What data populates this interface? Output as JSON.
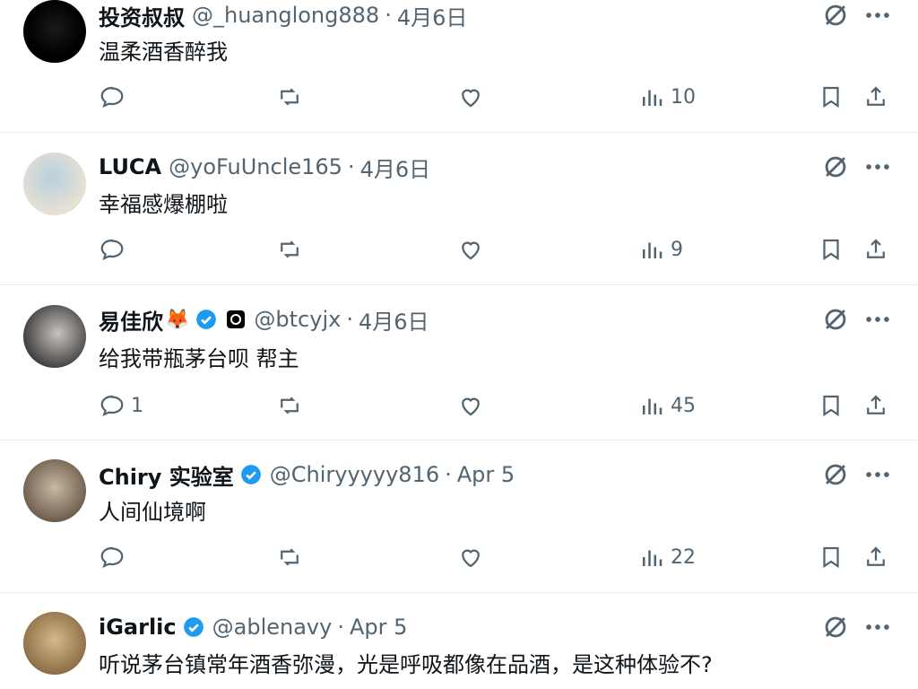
{
  "tweets": [
    {
      "name": "投资叔叔",
      "handle": "@_huanglong888",
      "time": "4月6日",
      "text": "温柔酒香醉我",
      "replies": "",
      "views": "10",
      "verified": false,
      "avatar_colors": [
        "#000000",
        "#222222"
      ]
    },
    {
      "name": "LUCA",
      "handle": "@yoFuUncle165",
      "time": "4月6日",
      "text": "幸福感爆棚啦",
      "replies": "",
      "views": "9",
      "verified": false,
      "avatar_colors": [
        "#9fb8c9",
        "#e9e3d6"
      ]
    },
    {
      "name": "易佳欣",
      "name_emoji": "🦊",
      "handle": "@btcyjx",
      "time": "4月6日",
      "text": "给我带瓶茅台呗  帮主",
      "replies": "1",
      "views": "45",
      "verified": true,
      "avatar_colors": [
        "#3a3a3a",
        "#c9c2bd"
      ]
    },
    {
      "name": "Chiry 实验室",
      "handle": "@Chiryyyyy816",
      "time": "Apr 5",
      "text": "人间仙境啊",
      "replies": "",
      "views": "22",
      "verified": true,
      "avatar_colors": [
        "#6b5a4a",
        "#c7b9a3"
      ]
    },
    {
      "name": "iGarlic",
      "handle": "@ablenavy",
      "time": "Apr 5",
      "text": "听说茅台镇常年酒香弥漫，光是呼吸都像在品酒，是这种体验不?",
      "replies": "",
      "views": "",
      "verified": true,
      "avatar_colors": [
        "#8a6a45",
        "#d6b98a"
      ]
    }
  ],
  "icons": {
    "reply": "reply-icon",
    "retweet": "retweet-icon",
    "like": "like-icon",
    "views": "views-icon",
    "bookmark": "bookmark-icon",
    "share": "share-icon",
    "grok": "grok-icon",
    "more": "more-icon",
    "verified": "verified-badge-icon"
  },
  "colors": {
    "text": "#0f1419",
    "secondary": "#536471",
    "verified": "#1d9bf0",
    "divider": "#e6ecf0"
  }
}
